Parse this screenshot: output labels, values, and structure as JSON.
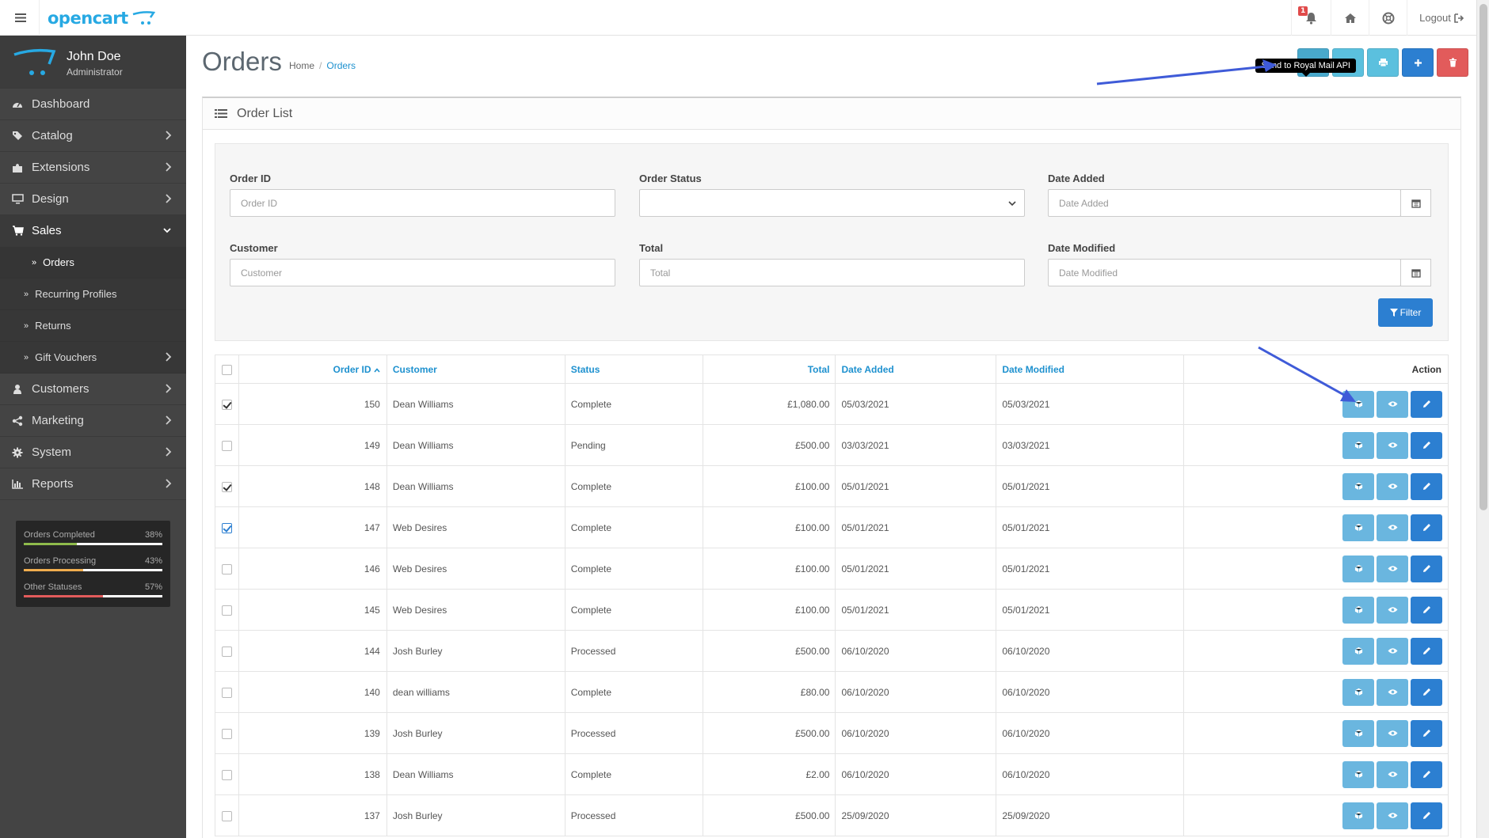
{
  "header": {
    "logo_text": "opencart",
    "notification_count": "1",
    "logout_label": "Logout"
  },
  "profile": {
    "name": "John Doe",
    "role": "Administrator"
  },
  "sidebar": {
    "items": [
      {
        "label": "Dashboard",
        "icon": "dashboard-icon"
      },
      {
        "label": "Catalog",
        "icon": "tags-icon"
      },
      {
        "label": "Extensions",
        "icon": "puzzle-icon"
      },
      {
        "label": "Design",
        "icon": "monitor-icon"
      },
      {
        "label": "Sales",
        "icon": "cart-icon"
      },
      {
        "label": "Customers",
        "icon": "user-icon"
      },
      {
        "label": "Marketing",
        "icon": "share-icon"
      },
      {
        "label": "System",
        "icon": "gear-icon"
      },
      {
        "label": "Reports",
        "icon": "bar-chart-icon"
      }
    ],
    "sales_sub": [
      {
        "label": "Orders"
      },
      {
        "label": "Recurring Profiles"
      },
      {
        "label": "Returns"
      },
      {
        "label": "Gift Vouchers"
      }
    ]
  },
  "stats": [
    {
      "label": "Orders Completed",
      "value": "38%",
      "fraction": 0.38,
      "color": "#8fbb4c"
    },
    {
      "label": "Orders Processing",
      "value": "43%",
      "fraction": 0.43,
      "color": "#f0ad4e"
    },
    {
      "label": "Other Statuses",
      "value": "57%",
      "fraction": 0.57,
      "color": "#e25b5b"
    }
  ],
  "page": {
    "title": "Orders",
    "breadcrumb_home": "Home",
    "breadcrumb_current": "Orders",
    "breadcrumb_sep": "/",
    "tooltip": "Send to Royal Mail API"
  },
  "panel": {
    "heading": "Order List"
  },
  "filter": {
    "order_id_label": "Order ID",
    "order_id_placeholder": "Order ID",
    "order_status_label": "Order Status",
    "date_added_label": "Date Added",
    "date_added_placeholder": "Date Added",
    "customer_label": "Customer",
    "customer_placeholder": "Customer",
    "total_label": "Total",
    "total_placeholder": "Total",
    "date_modified_label": "Date Modified",
    "date_modified_placeholder": "Date Modified",
    "filter_button": "Filter"
  },
  "table": {
    "headers": {
      "order_id": "Order ID",
      "customer": "Customer",
      "status": "Status",
      "total": "Total",
      "date_added": "Date Added",
      "date_modified": "Date Modified",
      "action": "Action"
    },
    "rows": [
      {
        "checked": "dark",
        "order_id": "150",
        "customer": "Dean Williams",
        "status": "Complete",
        "total": "£1,080.00",
        "date_added": "05/03/2021",
        "date_modified": "05/03/2021"
      },
      {
        "checked": "none",
        "order_id": "149",
        "customer": "Dean Williams",
        "status": "Pending",
        "total": "£500.00",
        "date_added": "03/03/2021",
        "date_modified": "03/03/2021"
      },
      {
        "checked": "dark",
        "order_id": "148",
        "customer": "Dean Williams",
        "status": "Complete",
        "total": "£100.00",
        "date_added": "05/01/2021",
        "date_modified": "05/01/2021"
      },
      {
        "checked": "blue",
        "order_id": "147",
        "customer": "Web Desires",
        "status": "Complete",
        "total": "£100.00",
        "date_added": "05/01/2021",
        "date_modified": "05/01/2021"
      },
      {
        "checked": "none",
        "order_id": "146",
        "customer": "Web Desires",
        "status": "Complete",
        "total": "£100.00",
        "date_added": "05/01/2021",
        "date_modified": "05/01/2021"
      },
      {
        "checked": "none",
        "order_id": "145",
        "customer": "Web Desires",
        "status": "Complete",
        "total": "£100.00",
        "date_added": "05/01/2021",
        "date_modified": "05/01/2021"
      },
      {
        "checked": "none",
        "order_id": "144",
        "customer": "Josh Burley",
        "status": "Processed",
        "total": "£500.00",
        "date_added": "06/10/2020",
        "date_modified": "06/10/2020"
      },
      {
        "checked": "none",
        "order_id": "140",
        "customer": "dean williams",
        "status": "Complete",
        "total": "£80.00",
        "date_added": "06/10/2020",
        "date_modified": "06/10/2020"
      },
      {
        "checked": "none",
        "order_id": "139",
        "customer": "Josh Burley",
        "status": "Processed",
        "total": "£500.00",
        "date_added": "06/10/2020",
        "date_modified": "06/10/2020"
      },
      {
        "checked": "none",
        "order_id": "138",
        "customer": "Dean Williams",
        "status": "Complete",
        "total": "£2.00",
        "date_added": "06/10/2020",
        "date_modified": "06/10/2020"
      },
      {
        "checked": "none",
        "order_id": "137",
        "customer": "Josh Burley",
        "status": "Processed",
        "total": "£500.00",
        "date_added": "25/09/2020",
        "date_modified": "25/09/2020"
      }
    ]
  }
}
